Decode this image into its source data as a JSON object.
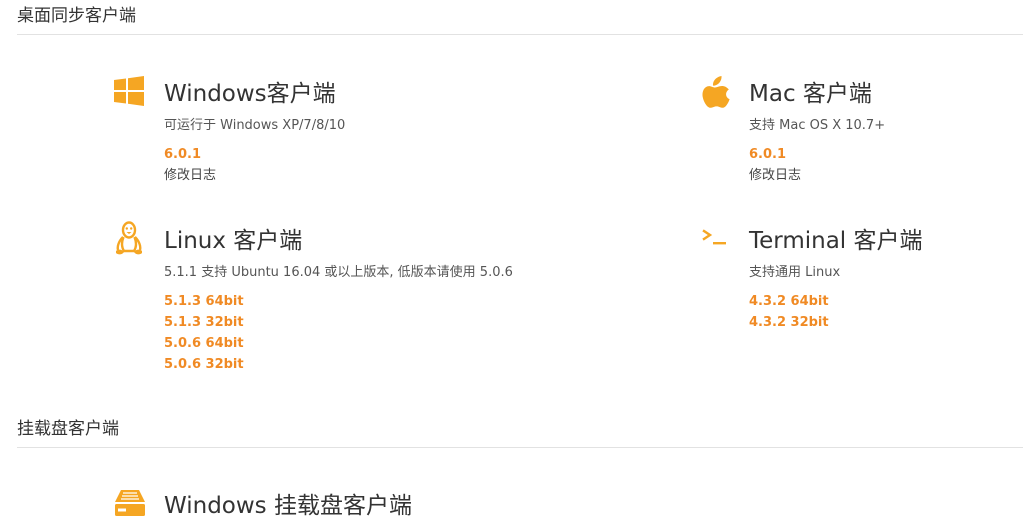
{
  "colors": {
    "accent": "#f08a24",
    "icon": "#f5a623",
    "divider": "#e2e2e2"
  },
  "sections": [
    {
      "title": "桌面同步客户端",
      "clients": [
        {
          "icon": "windows-icon",
          "name": "Windows客户端",
          "desc": "可运行于 Windows XP/7/8/10",
          "links": [
            "6.0.1",
            "修改日志"
          ]
        },
        {
          "icon": "apple-icon",
          "name": "Mac 客户端",
          "desc": "支持 Mac OS X 10.7+",
          "links": [
            "6.0.1",
            "修改日志"
          ]
        },
        {
          "icon": "linux-icon",
          "name": "Linux 客户端",
          "desc": "5.1.1 支持 Ubuntu 16.04 或以上版本, 低版本请使用 5.0.6",
          "links": [
            "5.1.3 64bit",
            "5.1.3 32bit",
            "5.0.6 64bit",
            "5.0.6 32bit"
          ]
        },
        {
          "icon": "terminal-icon",
          "name": "Terminal 客户端",
          "desc": "支持通用 Linux",
          "links": [
            "4.3.2 64bit",
            "4.3.2 32bit"
          ]
        }
      ]
    },
    {
      "title": "挂载盘客户端",
      "clients": [
        {
          "icon": "drive-icon",
          "name": "Windows 挂载盘客户端"
        }
      ]
    }
  ]
}
